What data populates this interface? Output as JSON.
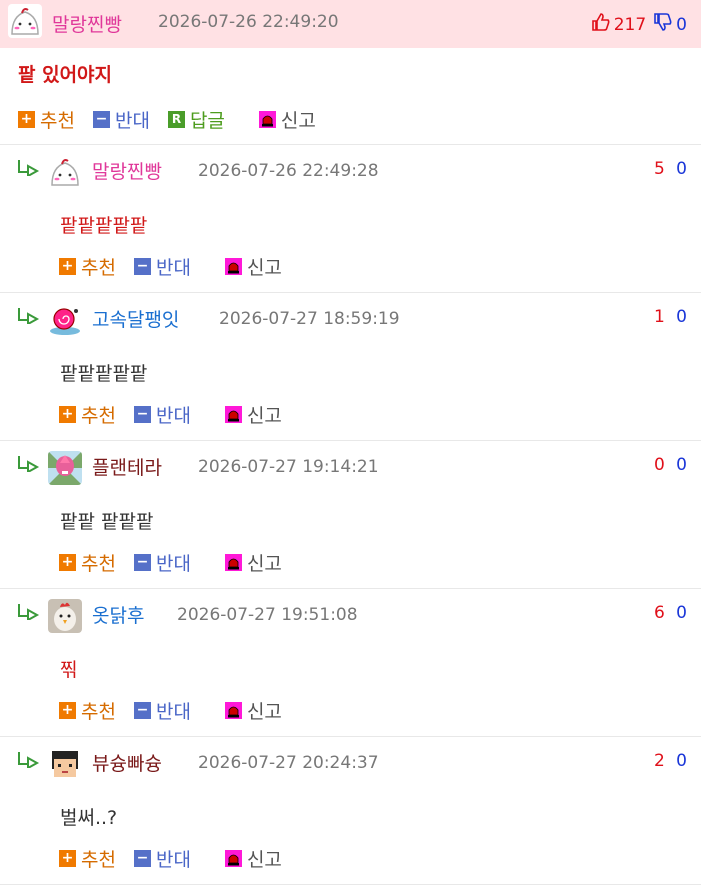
{
  "post": {
    "author": "말랑찐빵",
    "timestamp": "2026-07-26 22:49:20",
    "up_count": "217",
    "down_count": "0",
    "body": "팥 있어야지",
    "actions": {
      "recommend": "추천",
      "oppose": "반대",
      "reply": "답글",
      "report": "신고"
    }
  },
  "comments": [
    {
      "author": "말랑찐빵",
      "timestamp": "2026-07-26 22:49:28",
      "up": "5",
      "down": "0",
      "body": "팥팥팥팥팥"
    },
    {
      "author": "고속달팽잇",
      "timestamp": "2026-07-27 18:59:19",
      "up": "1",
      "down": "0",
      "body": "팥팥팥팥팥"
    },
    {
      "author": "플랜테라",
      "timestamp": "2026-07-27 19:14:21",
      "up": "0",
      "down": "0",
      "body": "팥팥 팥팥팥"
    },
    {
      "author": "옷닭후",
      "timestamp": "2026-07-27 19:51:08",
      "up": "6",
      "down": "0",
      "body": "찎"
    },
    {
      "author": "뷰슝빠슝",
      "timestamp": "2026-07-27 20:24:37",
      "up": "2",
      "down": "0",
      "body": "벌써..?"
    }
  ],
  "comment_actions": {
    "recommend": "추천",
    "oppose": "반대",
    "report": "신고"
  },
  "colors": {
    "header_bg": "#ffe1e4",
    "nick_pink": "#e0389a",
    "nick_blue": "#1a6fd0",
    "nick_dark": "#7a1a1a",
    "body_red": "#d11818",
    "up": "#e0101a",
    "down": "#1a36d8"
  }
}
